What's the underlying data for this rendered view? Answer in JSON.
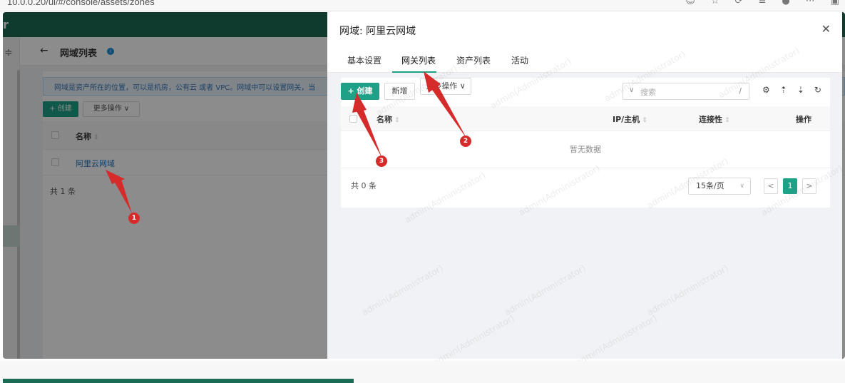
{
  "browser": {
    "url": "10.0.0.20/ui/#/console/assets/zones",
    "icons": [
      "settings-icon",
      "favorite-icon",
      "extensions-icon",
      "collections-icon",
      "profile-icon",
      "more-icon",
      "sidebar-icon"
    ]
  },
  "app": {
    "brand_letter": "r",
    "page": {
      "back_symbol": "←",
      "title": "网域列表",
      "info_symbol": "i",
      "note": "网域是资产所在的位置，可以是机房，公有云 或者 VPC。网域中可以设置网关，当",
      "create_label": "+ 创建",
      "more_label": "更多操作 ∨",
      "col_name": "名称",
      "row_name": "阿里云网域",
      "total": "共 1 条"
    }
  },
  "drawer": {
    "title": "网域: 阿里云网域",
    "close_symbol": "✕",
    "tabs": [
      "基本设置",
      "网关列表",
      "资产列表",
      "活动"
    ],
    "active_tab": "网关列表",
    "create_label": "+ 创建",
    "add_label": "新增",
    "more_label": "更多操作 ∨",
    "search_placeholder": "搜索",
    "search_key": "/",
    "columns": {
      "name": "名称",
      "ip": "IP/主机",
      "connectivity": "连接性",
      "actions": "操作"
    },
    "sort_symbol": "⇕",
    "empty_text": "暂无数据",
    "total": "共 0 条",
    "page_size": "15条/页",
    "pager": {
      "prev": "<",
      "current": "1",
      "next": ">"
    },
    "tool_icons": [
      "settings-icon",
      "import-icon",
      "export-icon",
      "refresh-icon"
    ]
  },
  "annotations": [
    "1",
    "2",
    "3"
  ],
  "watermark": "admin(Administrator)",
  "colors": {
    "primary": "#1ea186",
    "header": "#1c6b55",
    "annotation": "#d62b2b"
  }
}
